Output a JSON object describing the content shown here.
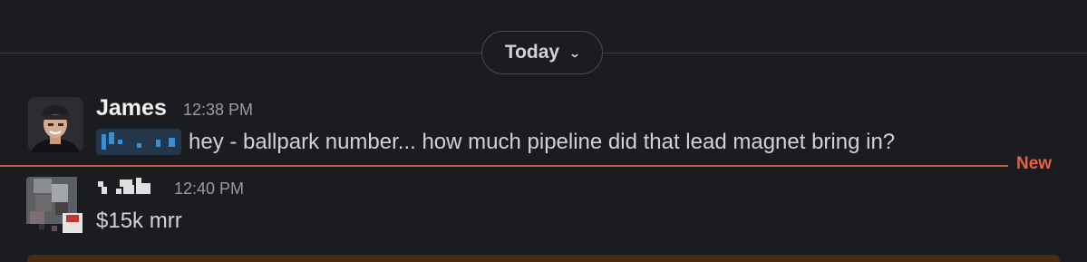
{
  "date_divider": {
    "label": "Today"
  },
  "messages": [
    {
      "author": "James",
      "time": "12:38 PM",
      "text": "hey - ballpark number... how much pipeline did that lead magnet bring in?"
    },
    {
      "author": "",
      "time": "12:40 PM",
      "text": "$15k mrr"
    }
  ],
  "new_marker": {
    "label": "New",
    "color": "#e8633f"
  },
  "icons": {
    "date_chevron": "chevron-down-icon"
  }
}
